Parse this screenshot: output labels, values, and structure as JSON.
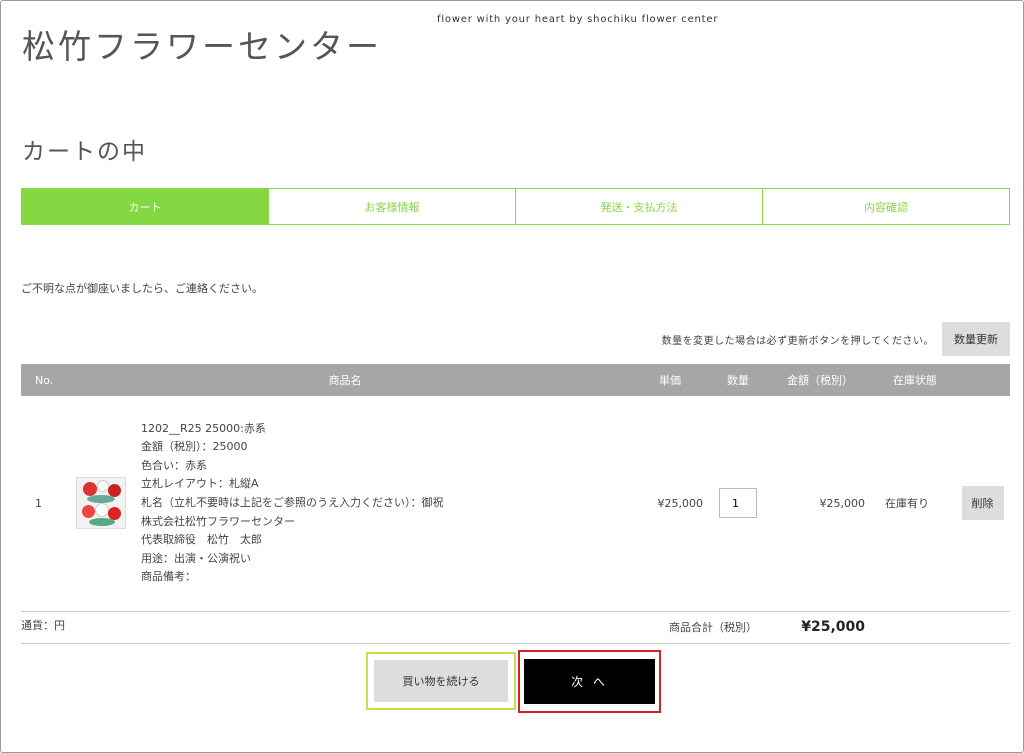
{
  "header": {
    "site_title": "松竹フラワーセンター",
    "tagline": "flower with your heart by shochiku flower center"
  },
  "page_heading": "カートの中",
  "steps": [
    {
      "label": "カート",
      "active": true
    },
    {
      "label": "お客様情報",
      "active": false
    },
    {
      "label": "発送・支払方法",
      "active": false
    },
    {
      "label": "内容確認",
      "active": false
    }
  ],
  "notice": "ご不明な点が御座いましたら、ご連絡ください。",
  "update": {
    "note": "数量を変更した場合は必ず更新ボタンを押してください。",
    "button_label": "数量更新"
  },
  "table": {
    "headers": {
      "no": "No.",
      "name": "商品名",
      "unit_price": "単価",
      "quantity": "数量",
      "amount": "金額（税別）",
      "stock": "在庫状態"
    },
    "items": [
      {
        "no": "1",
        "thumb_icon": "flower-stand-image",
        "lines": [
          "1202__R25 25000:赤系",
          "金額（税別）：25000",
          "色合い：赤系",
          "立札レイアウト：札縦A",
          "札名（立札不要時は上記をご参照のうえ入力ください）：御祝",
          "株式会社松竹フラワーセンター",
          "代表取締役　松竹　太郎",
          "用途：出演・公演祝い",
          "商品備考："
        ],
        "unit_price": "¥25,000",
        "quantity": "1",
        "amount": "¥25,000",
        "stock": "在庫有り",
        "delete_label": "削除"
      }
    ],
    "total_label": "商品合計（税別）",
    "total_value": "¥25,000"
  },
  "currency_note": "通貨：円",
  "actions": {
    "continue_label": "買い物を続ける",
    "next_label": "次 へ"
  },
  "colors": {
    "accent_green": "#84d842",
    "highlight_green": "#c7de4e",
    "highlight_red": "#d0202a",
    "table_header_gray": "#a6a6a6"
  }
}
